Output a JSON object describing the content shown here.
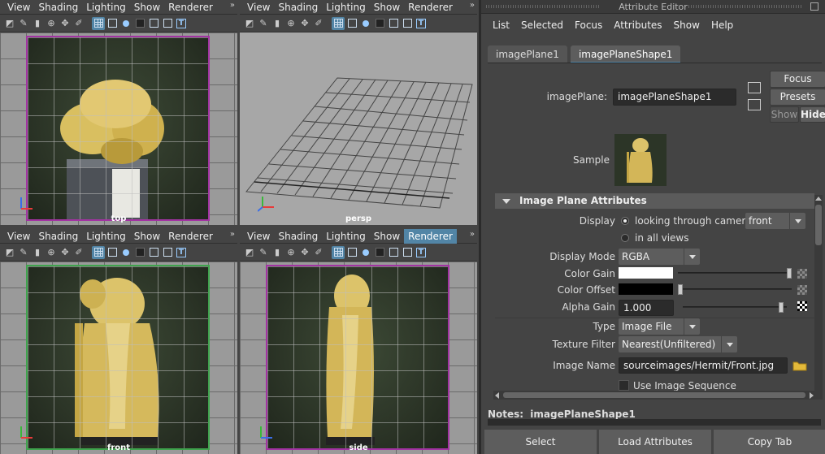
{
  "viewport_menu": [
    "View",
    "Shading",
    "Lighting",
    "Show",
    "Renderer"
  ],
  "viewports": {
    "top": {
      "label": "top"
    },
    "persp": {
      "label": "persp"
    },
    "front": {
      "label": "front"
    },
    "side": {
      "label": "side"
    }
  },
  "attribute_editor": {
    "title": "Attribute Editor",
    "menu": [
      "List",
      "Selected",
      "Focus",
      "Attributes",
      "Show",
      "Help"
    ],
    "tabs": [
      "imagePlane1",
      "imagePlaneShape1"
    ],
    "active_tab": "imagePlaneShape1",
    "node_label": "imagePlane:",
    "node_value": "imagePlaneShape1",
    "focus_button": "Focus",
    "presets_button": "Presets",
    "show_button": "Show",
    "hide_button": "Hide",
    "sample_label": "Sample",
    "section_title": "Image Plane Attributes",
    "display_label": "Display",
    "display_option_1": "looking through camera",
    "display_option_2": "in all views",
    "display_camera": "front",
    "display_mode_label": "Display Mode",
    "display_mode_value": "RGBA",
    "color_gain_label": "Color Gain",
    "color_gain_hex": "#ffffff",
    "color_gain_fraction": 1.0,
    "color_offset_label": "Color Offset",
    "color_offset_hex": "#000000",
    "color_offset_fraction": 0.0,
    "alpha_gain_label": "Alpha Gain",
    "alpha_gain_value": "1.000",
    "type_label": "Type",
    "type_value": "Image File",
    "texture_filter_label": "Texture Filter",
    "texture_filter_value": "Nearest(Unfiltered)",
    "image_name_label": "Image Name",
    "image_name_value": "sourceimages/Hermit/Front.jpg",
    "use_sequence_label": "Use Image Sequence",
    "notes_label": "Notes:",
    "notes_node": "imagePlaneShape1",
    "bottom_buttons": [
      "Select",
      "Load Attributes",
      "Copy Tab"
    ]
  },
  "colors": {
    "accent": "#5285a6",
    "frame_magenta": "#a233a2",
    "frame_green": "#3fa34d",
    "panel_bg": "#444444"
  }
}
